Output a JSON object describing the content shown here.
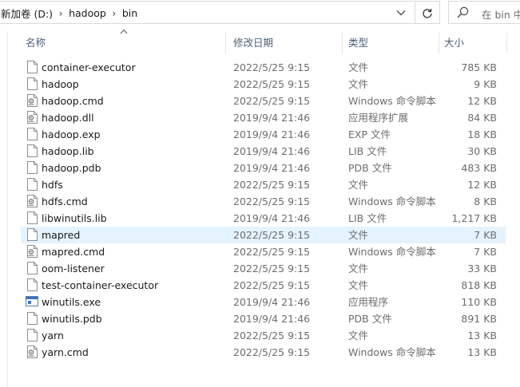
{
  "address_bar": {
    "breadcrumbs": [
      "新加卷 (D:)",
      "hadoop",
      "bin"
    ],
    "separator": "›"
  },
  "search": {
    "placeholder": "在 bin 中"
  },
  "columns": {
    "name": "名称",
    "date": "修改日期",
    "type": "类型",
    "size": "大小"
  },
  "selected_file": "mapred",
  "files": [
    {
      "name": "container-executor",
      "date": "2022/5/25 9:15",
      "type": "文件",
      "size": "785 KB",
      "icon": "file-icon"
    },
    {
      "name": "hadoop",
      "date": "2022/5/25 9:15",
      "type": "文件",
      "size": "9 KB",
      "icon": "file-icon"
    },
    {
      "name": "hadoop.cmd",
      "date": "2022/5/25 9:15",
      "type": "Windows 命令脚本",
      "size": "12 KB",
      "icon": "cmd-script-icon"
    },
    {
      "name": "hadoop.dll",
      "date": "2019/9/4 21:46",
      "type": "应用程序扩展",
      "size": "84 KB",
      "icon": "dll-icon"
    },
    {
      "name": "hadoop.exp",
      "date": "2019/9/4 21:46",
      "type": "EXP 文件",
      "size": "18 KB",
      "icon": "file-icon"
    },
    {
      "name": "hadoop.lib",
      "date": "2019/9/4 21:46",
      "type": "LIB 文件",
      "size": "30 KB",
      "icon": "file-icon"
    },
    {
      "name": "hadoop.pdb",
      "date": "2019/9/4 21:46",
      "type": "PDB 文件",
      "size": "483 KB",
      "icon": "file-icon"
    },
    {
      "name": "hdfs",
      "date": "2022/5/25 9:15",
      "type": "文件",
      "size": "12 KB",
      "icon": "file-icon"
    },
    {
      "name": "hdfs.cmd",
      "date": "2022/5/25 9:15",
      "type": "Windows 命令脚本",
      "size": "8 KB",
      "icon": "cmd-script-icon"
    },
    {
      "name": "libwinutils.lib",
      "date": "2019/9/4 21:46",
      "type": "LIB 文件",
      "size": "1,217 KB",
      "icon": "file-icon"
    },
    {
      "name": "mapred",
      "date": "2022/5/25 9:15",
      "type": "文件",
      "size": "7 KB",
      "icon": "file-icon"
    },
    {
      "name": "mapred.cmd",
      "date": "2022/5/25 9:15",
      "type": "Windows 命令脚本",
      "size": "7 KB",
      "icon": "cmd-script-icon"
    },
    {
      "name": "oom-listener",
      "date": "2022/5/25 9:15",
      "type": "文件",
      "size": "33 KB",
      "icon": "file-icon"
    },
    {
      "name": "test-container-executor",
      "date": "2022/5/25 9:15",
      "type": "文件",
      "size": "818 KB",
      "icon": "file-icon"
    },
    {
      "name": "winutils.exe",
      "date": "2019/9/4 21:46",
      "type": "应用程序",
      "size": "110 KB",
      "icon": "exe-icon"
    },
    {
      "name": "winutils.pdb",
      "date": "2019/9/4 21:46",
      "type": "PDB 文件",
      "size": "891 KB",
      "icon": "file-icon"
    },
    {
      "name": "yarn",
      "date": "2022/5/25 9:15",
      "type": "文件",
      "size": "13 KB",
      "icon": "file-icon"
    },
    {
      "name": "yarn.cmd",
      "date": "2022/5/25 9:15",
      "type": "Windows 命令脚本",
      "size": "13 KB",
      "icon": "cmd-script-icon"
    }
  ]
}
